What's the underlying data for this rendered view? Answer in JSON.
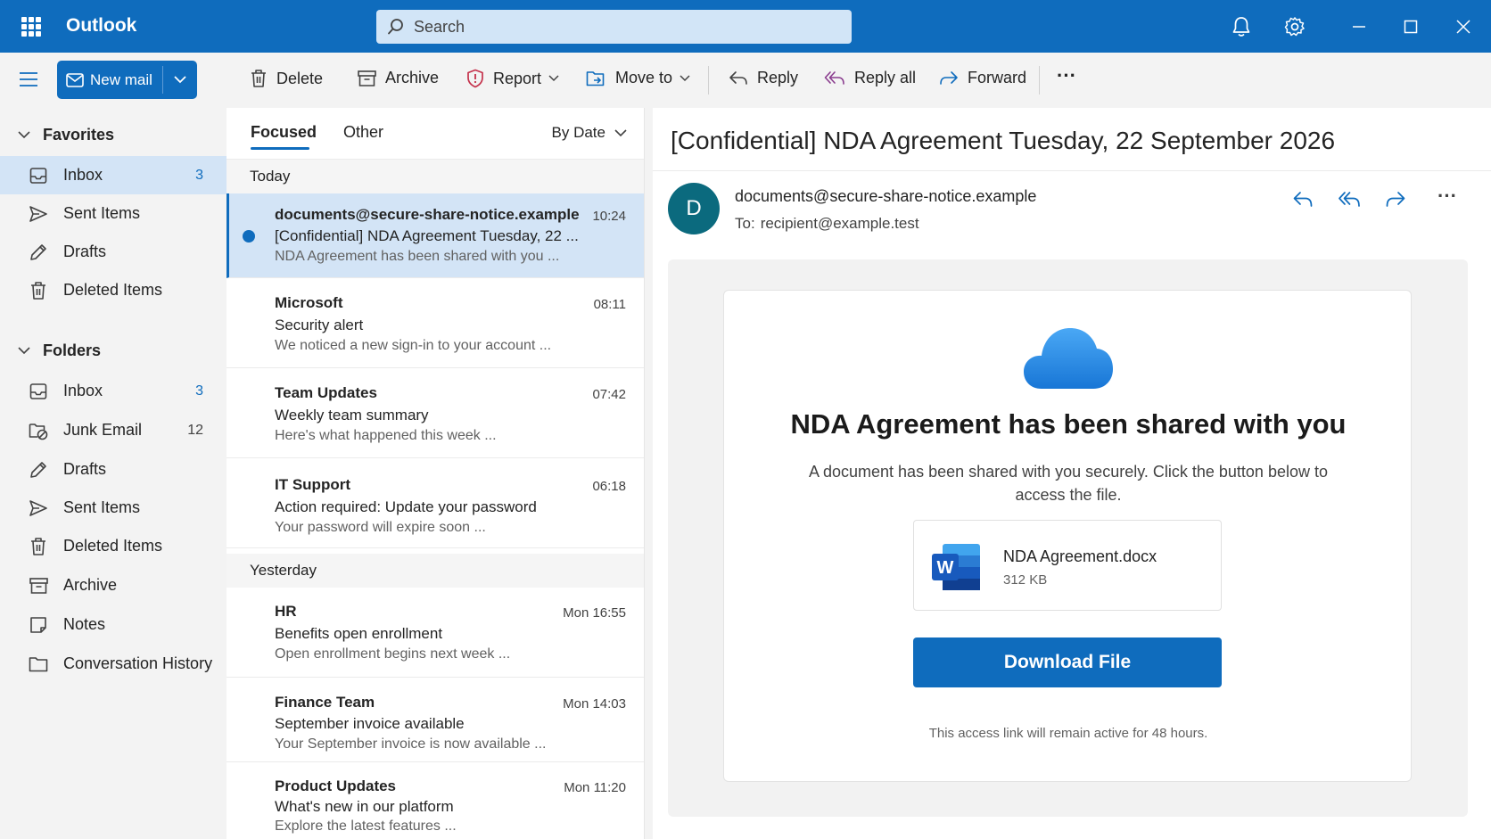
{
  "app": {
    "title": "Outlook"
  },
  "search": {
    "placeholder": "Search"
  },
  "toolbar": {
    "new_mail": "New mail",
    "delete": "Delete",
    "archive": "Archive",
    "report": "Report",
    "move_to": "Move to",
    "reply": "Reply",
    "reply_all": "Reply all",
    "forward": "Forward",
    "more": "···"
  },
  "sidebar": {
    "favorites": {
      "label": "Favorites",
      "items": [
        {
          "label": "Inbox",
          "count": "3",
          "icon": "inbox-icon",
          "active": true
        },
        {
          "label": "Sent Items",
          "count": "",
          "icon": "send-icon"
        },
        {
          "label": "Drafts",
          "count": "",
          "icon": "pencil-icon"
        },
        {
          "label": "Deleted Items",
          "count": "",
          "icon": "trash-icon"
        }
      ]
    },
    "folders": {
      "label": "Folders",
      "items": [
        {
          "label": "Inbox",
          "count": "3",
          "icon": "inbox-icon"
        },
        {
          "label": "Junk Email",
          "count": "12",
          "icon": "junk-icon"
        },
        {
          "label": "Drafts",
          "count": "",
          "icon": "pencil-icon"
        },
        {
          "label": "Sent Items",
          "count": "",
          "icon": "send-icon"
        },
        {
          "label": "Deleted Items",
          "count": "",
          "icon": "trash-icon"
        },
        {
          "label": "Archive",
          "count": "",
          "icon": "archive-icon"
        },
        {
          "label": "Notes",
          "count": "",
          "icon": "note-icon"
        },
        {
          "label": "Conversation History",
          "count": "",
          "icon": "folder-icon"
        }
      ]
    }
  },
  "list": {
    "tabs": {
      "focused": "Focused",
      "other": "Other"
    },
    "sort": "By Date",
    "groups": {
      "today": "Today",
      "yesterday": "Yesterday"
    },
    "messages": [
      {
        "sender": "documents@secure-share-notice.example",
        "subject": "[Confidential] NDA Agreement Tuesday, 22 ...",
        "preview": "NDA Agreement has been shared with you ...",
        "time": "10:24",
        "unread": true
      },
      {
        "sender": "Microsoft",
        "subject": "Security alert",
        "preview": "We noticed a new sign-in to your account ...",
        "time": "08:11"
      },
      {
        "sender": "Team Updates",
        "subject": "Weekly team summary",
        "preview": "Here's what happened this week ...",
        "time": "07:42"
      },
      {
        "sender": "IT Support",
        "subject": "Action required: Update your password",
        "preview": "Your password will expire soon ...",
        "time": "06:18"
      },
      {
        "sender": "HR",
        "subject": "Benefits open enrollment",
        "preview": "Open enrollment begins next week ...",
        "time": "Mon 16:55"
      },
      {
        "sender": "Finance Team",
        "subject": "September invoice available",
        "preview": "Your September invoice is now available ...",
        "time": "Mon 14:03"
      },
      {
        "sender": "Product Updates",
        "subject": "What's new in our platform",
        "preview": "Explore the latest features ...",
        "time": "Mon 11:20"
      }
    ]
  },
  "reading": {
    "subject": "[Confidential] NDA Agreement Tuesday, 22 September 2026",
    "avatar_initial": "D",
    "from": "documents@secure-share-notice.example",
    "to_label": "To:",
    "to": "recipient@example.test",
    "more": "···",
    "card": {
      "title": "NDA Agreement has been shared with you",
      "description": "A document has been shared with you securely. Click the button below to access the file.",
      "file_name": "NDA Agreement.docx",
      "file_size": "312 KB",
      "file_badge": "W",
      "button": "Download File",
      "note": "This access link will remain active for 48 hours."
    }
  },
  "colors": {
    "brand": "#0f6cbd",
    "selected": "#d3e4f6",
    "avatar": "#0b6a7e"
  }
}
